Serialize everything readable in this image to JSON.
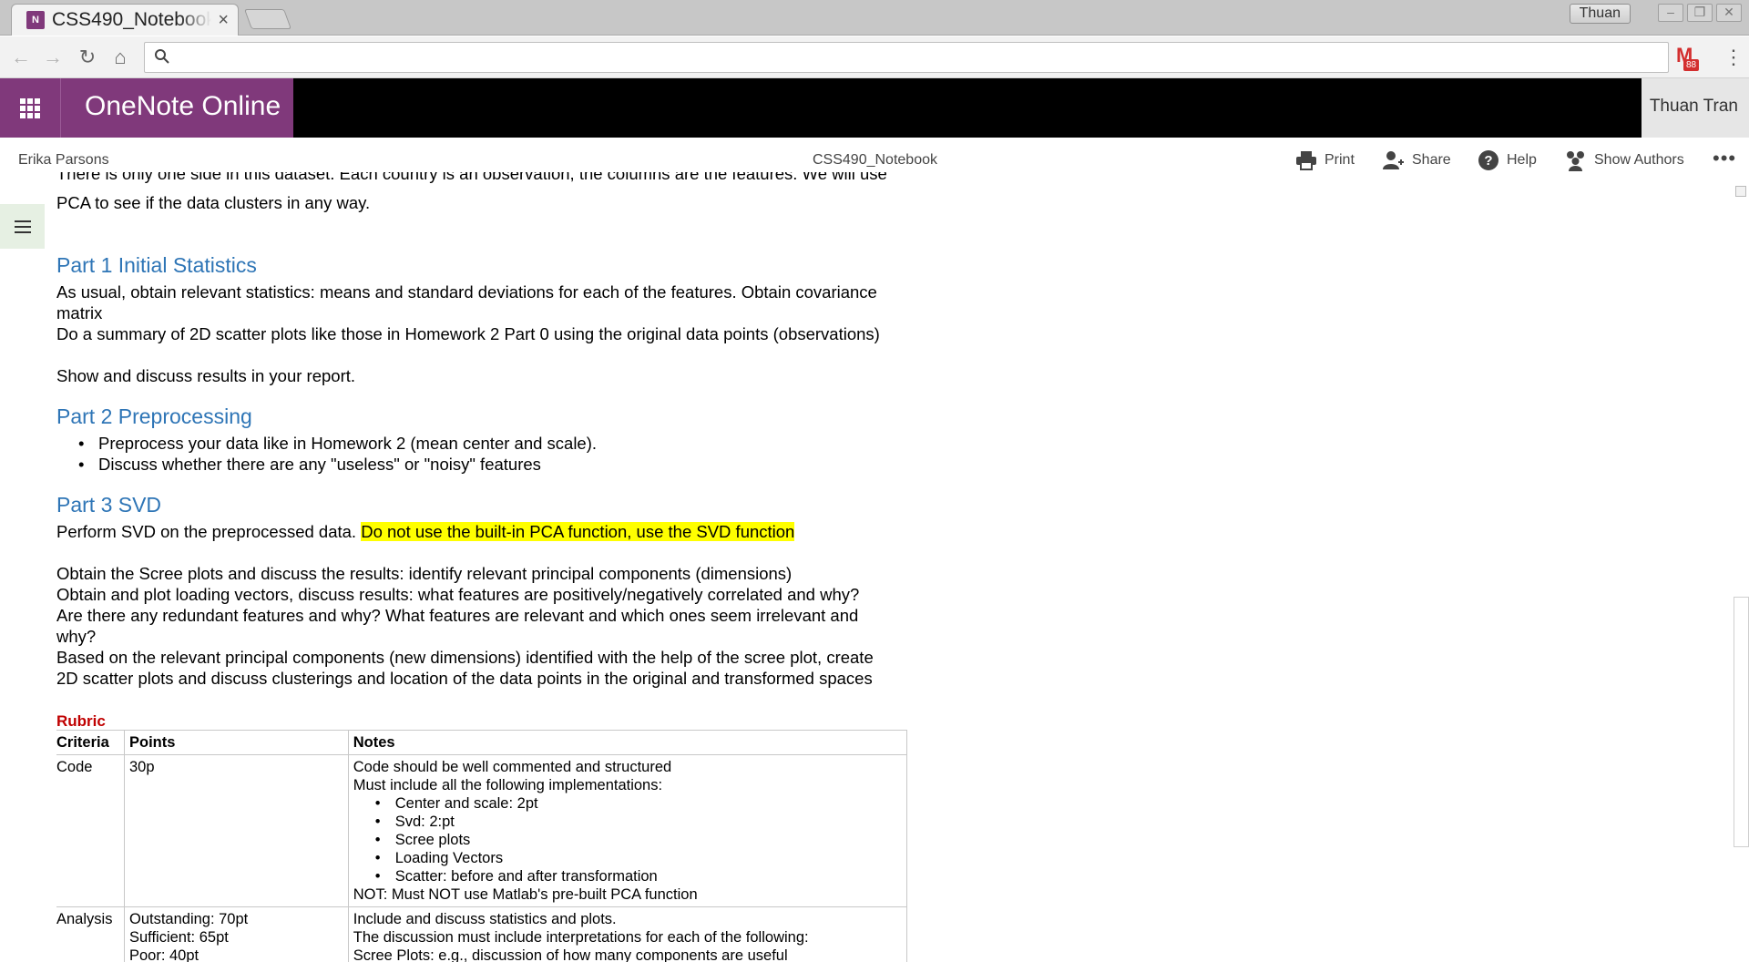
{
  "browser": {
    "tab_title": "CSS490_Notebook",
    "profile_name": "Thuan",
    "gmail_badge": "88",
    "favicon_letter": "N"
  },
  "app": {
    "name": "OneNote Online",
    "user": "Thuan Tran",
    "brand_color": "#80397b"
  },
  "commandbar": {
    "owner": "Erika Parsons",
    "notebook": "CSS490_Notebook",
    "print": "Print",
    "share": "Share",
    "help": "Help",
    "show_authors": "Show Authors"
  },
  "content": {
    "cut_line": "There is only one side in this dataset. Each country is an observation, the columns are the features. We will use",
    "intro_line2": "PCA to see if the data clusters in any way.",
    "part1": {
      "heading": "Part 1 Initial Statistics",
      "line1": "As usual, obtain relevant statistics: means and standard deviations for each of the features.  Obtain covariance",
      "line2": "matrix",
      "line3": "Do a summary of 2D scatter plots like those in Homework 2 Part 0 using the original data points (observations)",
      "line4": "Show and discuss results in your report."
    },
    "part2": {
      "heading": "Part 2 Preprocessing",
      "bullets": [
        "Preprocess your data like in Homework 2 (mean center and scale).",
        "Discuss whether there are any \"useless\" or \"noisy\" features"
      ]
    },
    "part3": {
      "heading": "Part 3 SVD",
      "line1": "Perform SVD on the preprocessed data.  ",
      "highlight": "Do not use the built-in PCA function, use the SVD function",
      "line2": "Obtain the Scree plots and discuss the results: identify relevant principal components (dimensions)",
      "line3": "Obtain and plot loading vectors, discuss results:  what features are positively/negatively correlated and why?",
      "line4": "Are there any redundant features and why? What features are relevant and which ones seem irrelevant and",
      "line5": "why?",
      "line6": "Based on the relevant principal components (new dimensions) identified with the help of the scree plot, create",
      "line7": "2D scatter plots and discuss clusterings and location of the data points in the original and transformed spaces"
    },
    "rubric": {
      "label": "Rubric",
      "headers": [
        "Criteria",
        "Points",
        "Notes"
      ],
      "code": {
        "criteria": "Code",
        "points": "30p",
        "note1": "Code should be well commented and structured",
        "note2": "Must include all the following implementations:",
        "items": [
          "Center and scale: 2pt",
          "Svd: 2:pt",
          "Scree plots",
          "Loading Vectors",
          "Scatter:  before and after transformation"
        ],
        "note3": "NOT: Must NOT use Matlab's pre-built PCA function"
      },
      "analysis": {
        "criteria": "Analysis",
        "points": [
          "Outstanding: 70pt",
          "Sufficient: 65pt",
          "Poor: 40pt"
        ],
        "notes": [
          "Include and discuss statistics and plots.",
          "The discussion must include interpretations for each of the following:",
          "Scree Plots: e.g., discussion of how many components are useful"
        ]
      }
    }
  }
}
